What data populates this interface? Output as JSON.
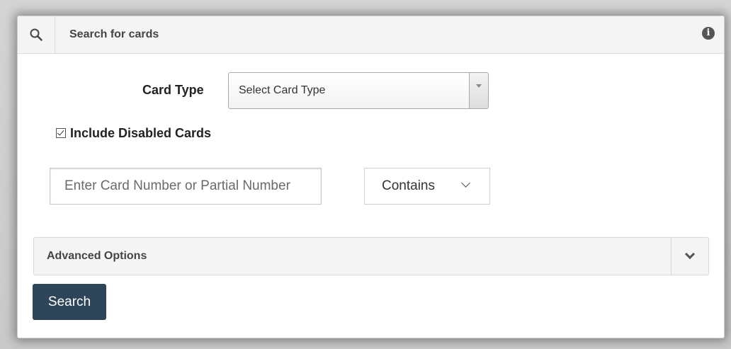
{
  "header": {
    "title": "Search for cards",
    "search_icon": "search-icon",
    "info_icon": "info-icon"
  },
  "card_type": {
    "label": "Card Type",
    "selected": "Select Card Type"
  },
  "include_disabled": {
    "label": "Include Disabled Cards",
    "checked": true
  },
  "card_number": {
    "placeholder": "Enter Card Number or Partial Number",
    "value": ""
  },
  "match_mode": {
    "selected": "Contains"
  },
  "advanced": {
    "label": "Advanced Options",
    "toggle_icon": "chevron-down-icon"
  },
  "actions": {
    "search_label": "Search"
  },
  "colors": {
    "primary_button": "#2e4459",
    "header_bg": "#f4f4f4"
  }
}
